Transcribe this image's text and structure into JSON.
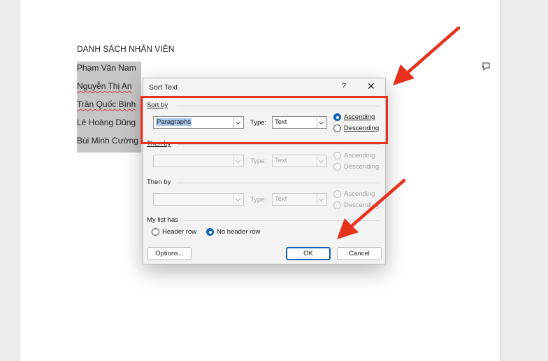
{
  "document": {
    "title": "DANH SÁCH NHÂN VIÊN",
    "lines": [
      "Phạm Văn Nam",
      "Nguyễn Thị An",
      "Trần Quốc Bình",
      "Lê Hoàng Dũng",
      "Bùi Minh Cường"
    ]
  },
  "dialog": {
    "title": "Sort Text",
    "help": "?",
    "close": "✕",
    "sort_by": {
      "label": "Sort by",
      "field": "Paragraphs",
      "type_label": "Type:",
      "type_value": "Text",
      "ascending": "Ascending",
      "descending": "Descending",
      "selected": "ascending"
    },
    "then_by_1": {
      "label": "Then by",
      "field": "",
      "type_label": "Type:",
      "type_value": "Text",
      "ascending": "Ascending",
      "descending": "Descending"
    },
    "then_by_2": {
      "label": "Then by",
      "field": "",
      "type_label": "Type:",
      "type_value": "Text",
      "ascending": "Ascending",
      "descending": "Descending"
    },
    "my_list_has": {
      "label": "My list has",
      "header_row": "Header row",
      "no_header_row": "No header row",
      "selected": "no_header_row"
    },
    "buttons": {
      "options": "Options...",
      "ok": "OK",
      "cancel": "Cancel"
    }
  },
  "colors": {
    "annotation_red": "#e8311d",
    "accent_blue": "#0f62b8",
    "selection_gray": "#c6c6c6"
  }
}
